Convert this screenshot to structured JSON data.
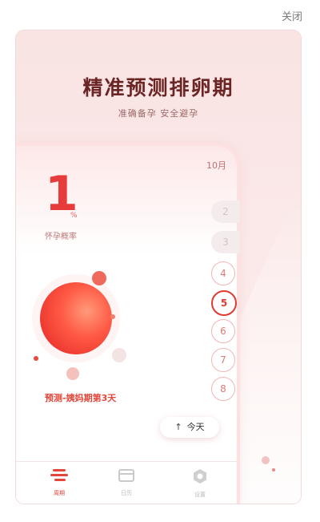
{
  "dialog": {
    "close_label": "关闭"
  },
  "promo": {
    "headline": "精准预测排卵期",
    "subtitle": "准确备孕 安全避孕"
  },
  "app": {
    "month": "10月",
    "probability_value": "1",
    "probability_unit": "%",
    "probability_label": "怀孕概率",
    "status_text": "预测-姨妈期第3天",
    "today_button": "今天",
    "days": [
      {
        "label": "2",
        "state": "past"
      },
      {
        "label": "3",
        "state": "past"
      },
      {
        "label": "4",
        "state": "future"
      },
      {
        "label": "5",
        "state": "today"
      },
      {
        "label": "6",
        "state": "future"
      },
      {
        "label": "7",
        "state": "future"
      },
      {
        "label": "8",
        "state": "future"
      }
    ],
    "nav": [
      {
        "label": "周期",
        "icon": "cycle-icon",
        "active": true
      },
      {
        "label": "日历",
        "icon": "calendar-icon",
        "active": false
      },
      {
        "label": "设置",
        "icon": "settings-icon",
        "active": false
      }
    ]
  },
  "colors": {
    "accent": "#e2473b",
    "headline": "#6b2525",
    "card_bg": "#f9e3e3"
  }
}
